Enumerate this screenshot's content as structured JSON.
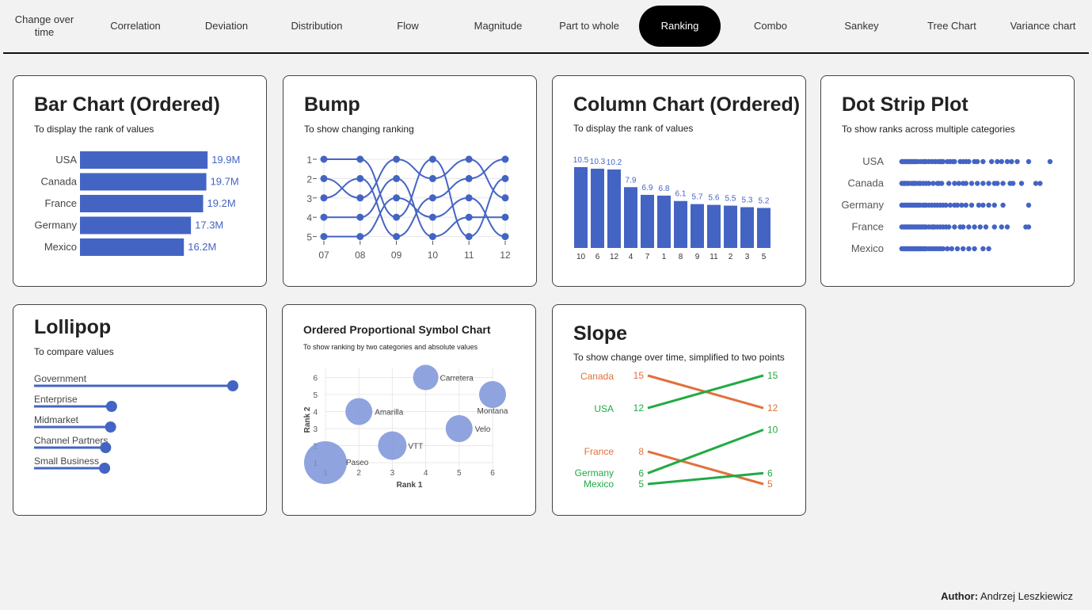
{
  "nav": {
    "items": [
      "Change over time",
      "Correlation",
      "Deviation",
      "Distribution",
      "Flow",
      "Magnitude",
      "Part to whole",
      "Ranking",
      "Combo",
      "Sankey",
      "Tree Chart",
      "Variance chart"
    ],
    "active": "Ranking"
  },
  "colors": {
    "accent": "#4464c4",
    "bubble": "#7b93d8",
    "orange": "#e2703a",
    "green": "#22aa44"
  },
  "cards": {
    "bar": {
      "title": "Bar Chart (Ordered)",
      "subtitle": "To display the rank of values"
    },
    "bump": {
      "title": "Bump",
      "subtitle": "To show changing ranking"
    },
    "column": {
      "title": "Column Chart (Ordered)",
      "subtitle": "To display the rank of values"
    },
    "dot": {
      "title": "Dot Strip Plot",
      "subtitle": "To show ranks across multiple categories"
    },
    "lollipop": {
      "title": "Lollipop",
      "subtitle": "To compare values"
    },
    "symbol": {
      "title": "Ordered Proportional Symbol Chart",
      "subtitle": "To show ranking by two categories and absolute values"
    },
    "slope": {
      "title": "Slope",
      "subtitle": "To show change over time, simplified to two points"
    }
  },
  "chart_data": [
    {
      "id": "bar",
      "type": "bar",
      "orientation": "horizontal",
      "categories": [
        "USA",
        "Canada",
        "France",
        "Germany",
        "Mexico"
      ],
      "values": [
        19.9,
        19.7,
        19.2,
        17.3,
        16.2
      ],
      "value_labels": [
        "19.9M",
        "19.7M",
        "19.2M",
        "17.3M",
        "16.2M"
      ]
    },
    {
      "id": "bump",
      "type": "line",
      "x": [
        "07",
        "08",
        "09",
        "10",
        "11",
        "12"
      ],
      "ylim": [
        1,
        5
      ],
      "y_ticks": [
        "1",
        "2",
        "3",
        "4",
        "5"
      ],
      "series": [
        {
          "values": [
            1,
            1,
            4,
            1,
            5,
            2
          ]
        },
        {
          "values": [
            2,
            3,
            1,
            2,
            1,
            3
          ]
        },
        {
          "values": [
            3,
            2,
            5,
            3,
            2,
            1
          ]
        },
        {
          "values": [
            4,
            4,
            2,
            5,
            4,
            4
          ]
        },
        {
          "values": [
            5,
            5,
            3,
            4,
            3,
            5
          ]
        }
      ]
    },
    {
      "id": "column",
      "type": "bar",
      "categories": [
        "10",
        "6",
        "12",
        "4",
        "7",
        "1",
        "8",
        "9",
        "11",
        "2",
        "3",
        "5"
      ],
      "values": [
        10.5,
        10.3,
        10.2,
        7.9,
        6.9,
        6.8,
        6.1,
        5.7,
        5.6,
        5.5,
        5.3,
        5.2
      ],
      "value_labels": [
        "10.5",
        "10.3",
        "10.2",
        "7.9",
        "6.9",
        "6.8",
        "6.1",
        "5.7",
        "5.6",
        "5.5",
        "5.3",
        "5.2"
      ]
    },
    {
      "id": "dot",
      "type": "scatter",
      "categories": [
        "USA",
        "Canada",
        "Germany",
        "France",
        "Mexico"
      ],
      "series": [
        {
          "values": [
            1,
            2,
            3,
            4,
            5,
            6,
            7,
            8,
            9,
            10,
            11,
            12,
            14,
            16,
            17,
            18,
            20,
            22,
            24,
            25,
            27,
            28,
            29,
            30,
            33,
            35,
            37,
            38,
            42,
            44,
            46,
            48,
            52,
            54,
            58,
            64,
            68,
            71,
            75,
            78,
            82,
            90,
            105
          ]
        },
        {
          "values": [
            1,
            2,
            3,
            4,
            5,
            6,
            8,
            9,
            10,
            11,
            13,
            14,
            16,
            18,
            20,
            23,
            26,
            27,
            29,
            34,
            38,
            41,
            44,
            46,
            50,
            54,
            58,
            62,
            66,
            68,
            72,
            77,
            79,
            85,
            95,
            98
          ]
        },
        {
          "values": [
            1,
            2,
            3,
            4,
            5,
            6,
            7,
            8,
            9,
            10,
            11,
            12,
            13,
            14,
            16,
            17,
            18,
            20,
            22,
            24,
            26,
            28,
            30,
            32,
            35,
            38,
            40,
            43,
            46,
            50,
            55,
            58,
            62,
            66,
            72,
            90
          ]
        },
        {
          "values": [
            1,
            2,
            3,
            4,
            5,
            6,
            7,
            8,
            9,
            10,
            11,
            12,
            13,
            14,
            15,
            16,
            17,
            18,
            20,
            22,
            23,
            24,
            26,
            28,
            30,
            32,
            34,
            38,
            42,
            44,
            48,
            52,
            56,
            60,
            66,
            71,
            75,
            88,
            90
          ]
        },
        {
          "values": [
            1,
            2,
            3,
            4,
            5,
            6,
            7,
            8,
            9,
            10,
            11,
            12,
            13,
            14,
            15,
            16,
            17,
            18,
            20,
            22,
            24,
            26,
            28,
            30,
            33,
            36,
            40,
            44,
            48,
            52,
            58,
            62
          ]
        }
      ]
    },
    {
      "id": "lollipop",
      "type": "bar",
      "orientation": "horizontal",
      "categories": [
        "Government",
        "Enterprise",
        "Midmarket",
        "Channel Partners",
        "Small Business"
      ],
      "values": [
        100,
        39,
        38.5,
        36,
        35.5
      ]
    },
    {
      "id": "symbol",
      "type": "scatter",
      "xlabel": "Rank 1",
      "ylabel": "Rank 2",
      "xlim": [
        1,
        6
      ],
      "ylim": [
        1,
        6
      ],
      "x_ticks": [
        "1",
        "2",
        "3",
        "4",
        "5",
        "6"
      ],
      "y_ticks": [
        "1",
        "2",
        "3",
        "4",
        "5",
        "6"
      ],
      "points": [
        {
          "label": "Carretera",
          "x": 4,
          "y": 6,
          "size": 16
        },
        {
          "label": "Montana",
          "x": 6,
          "y": 5,
          "size": 17
        },
        {
          "label": "Amarilla",
          "x": 2,
          "y": 4,
          "size": 17
        },
        {
          "label": "Velo",
          "x": 5,
          "y": 3,
          "size": 17
        },
        {
          "label": "VTT",
          "x": 3,
          "y": 2,
          "size": 18
        },
        {
          "label": "Paseo",
          "x": 1,
          "y": 1,
          "size": 27
        }
      ]
    },
    {
      "id": "slope",
      "type": "line",
      "series": [
        {
          "name": "Canada",
          "start": 15,
          "end": 12,
          "color": "orange"
        },
        {
          "name": "USA",
          "start": 12,
          "end": 15,
          "color": "green"
        },
        {
          "name": "France",
          "start": 8,
          "end": 5,
          "color": "orange"
        },
        {
          "name": "Germany",
          "start": 6,
          "end": 10,
          "color": "green"
        },
        {
          "name": "Mexico",
          "start": 5,
          "end": 6,
          "color": "green"
        }
      ]
    }
  ],
  "footer": {
    "author_label": "Author:",
    "author_name": "Andrzej Leszkiewicz"
  }
}
